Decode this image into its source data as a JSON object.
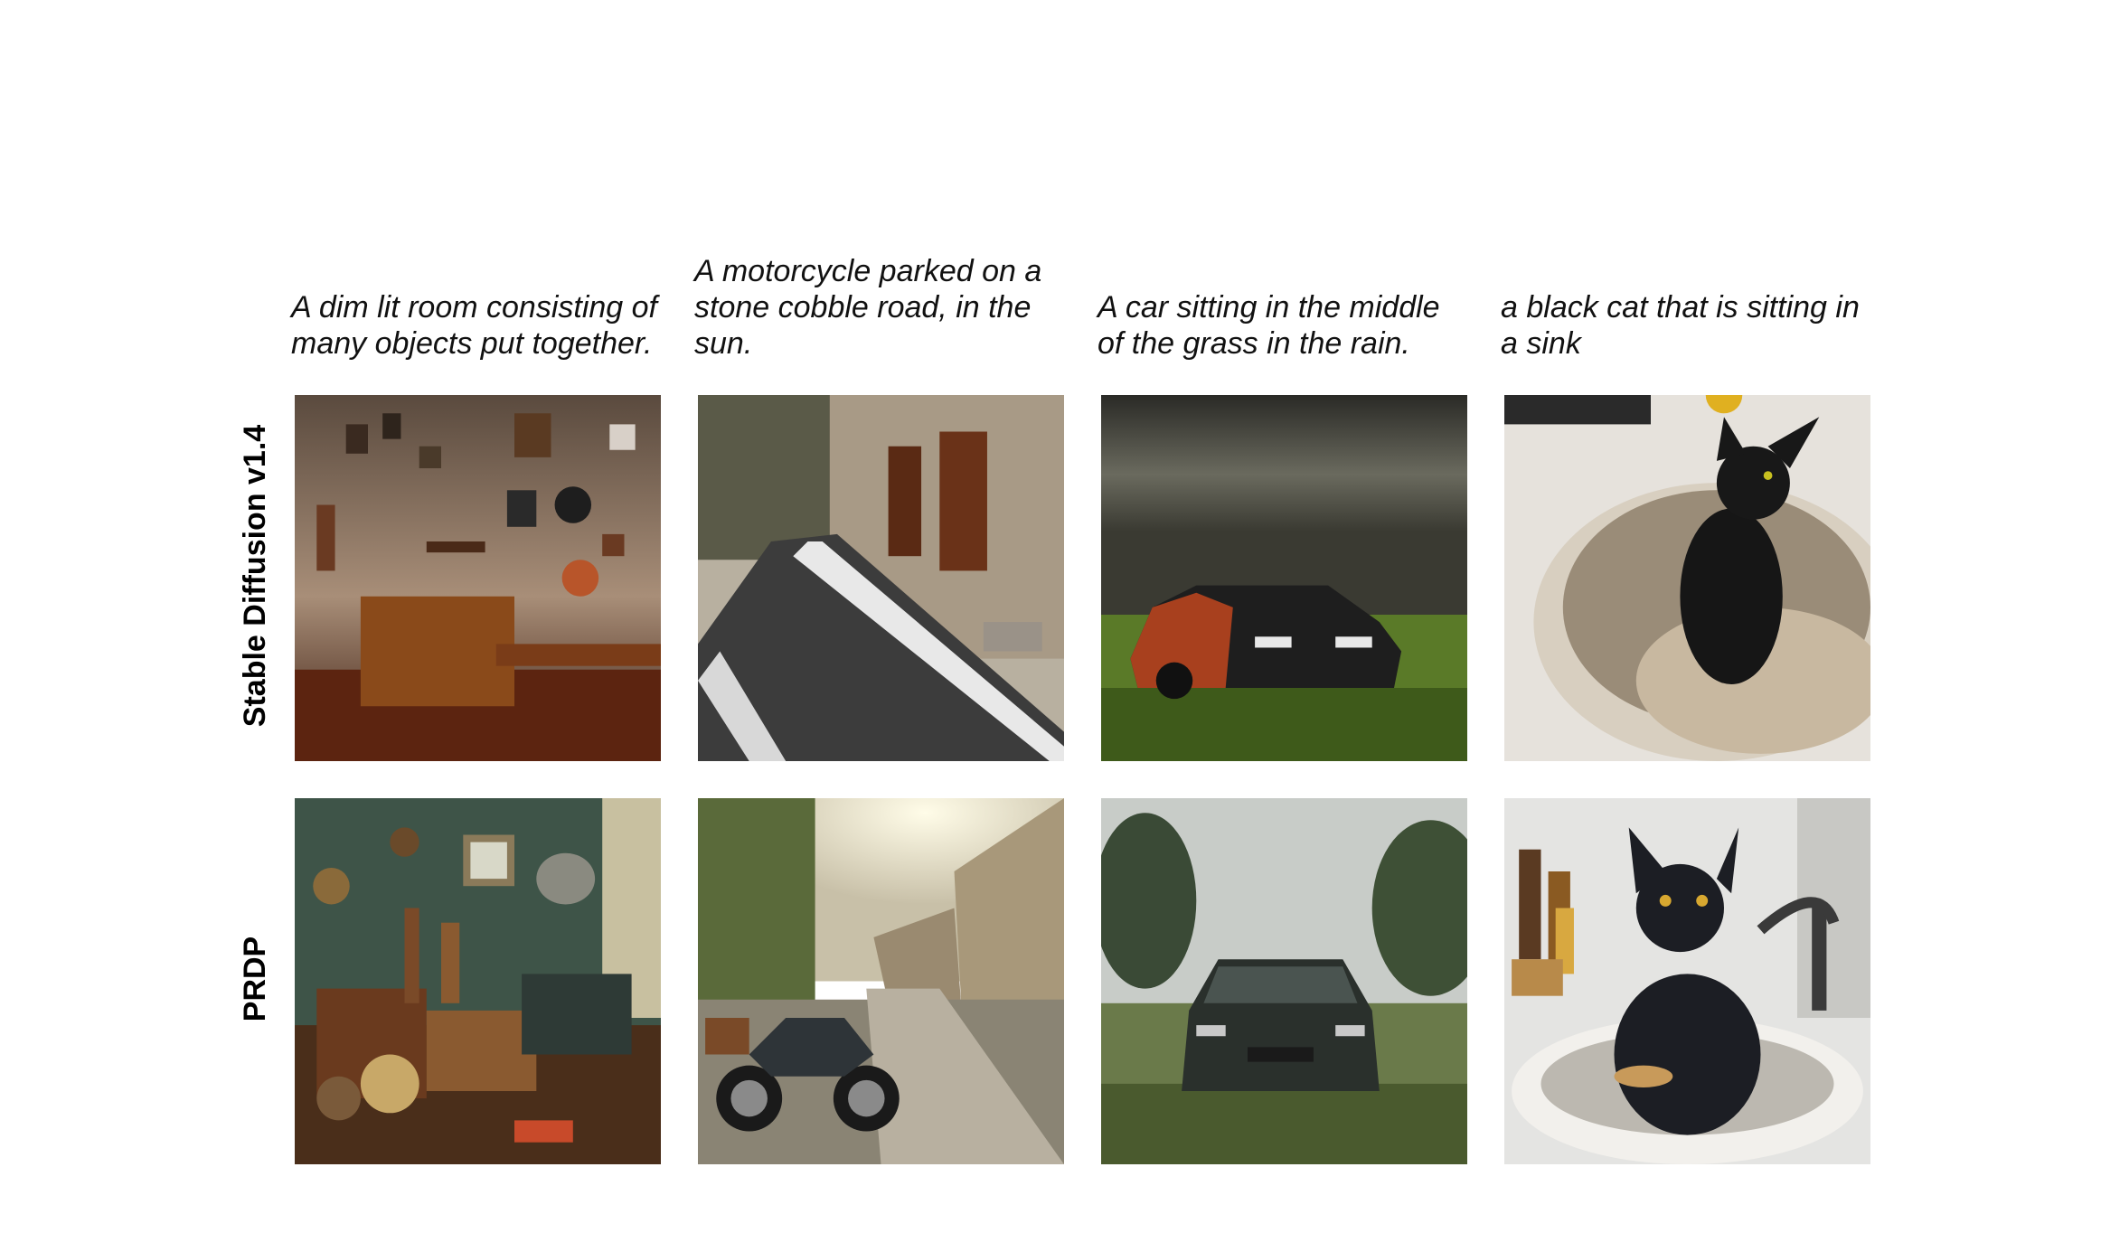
{
  "captions": [
    "A dim lit room consisting of many objects put together.",
    "A motorcycle parked on a stone cobble road, in the sun.",
    "A car sitting in the middle of the grass in the rain.",
    "a black cat that is sitting in a sink"
  ],
  "rows": [
    {
      "label": "Stable Diffusion v1.4"
    },
    {
      "label": "PRDP"
    }
  ]
}
